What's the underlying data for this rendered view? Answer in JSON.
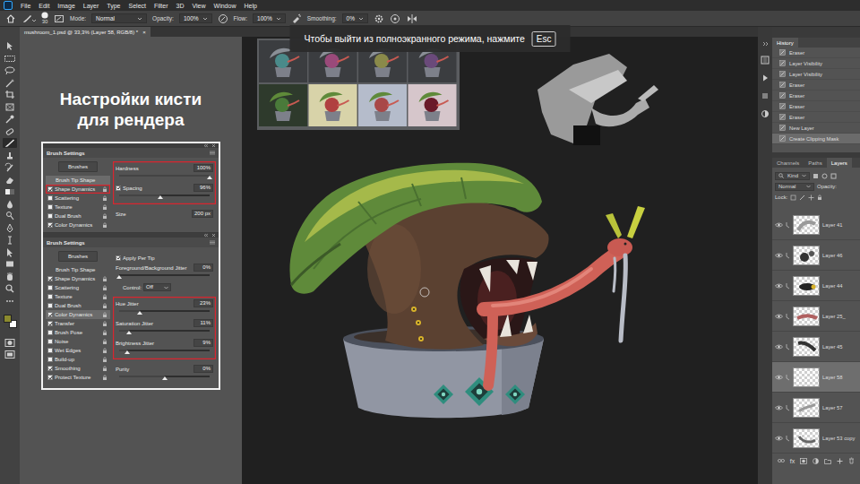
{
  "menu": {
    "items": [
      "File",
      "Edit",
      "Image",
      "Layer",
      "Type",
      "Select",
      "Filter",
      "3D",
      "View",
      "Window",
      "Help"
    ]
  },
  "options_bar": {
    "brush_size": "30",
    "mode_label": "Mode:",
    "mode": "Normal",
    "opacity_label": "Opacity:",
    "opacity": "100%",
    "flow_label": "Flow:",
    "flow": "100%",
    "smoothing_label": "Smoothing:",
    "smoothing": "0%"
  },
  "tools": [
    {
      "selected": false
    },
    {
      "selected": false
    },
    {
      "selected": false
    },
    {
      "selected": false
    },
    {
      "selected": false
    },
    {
      "selected": false
    },
    {
      "selected": false
    },
    {
      "selected": false
    },
    {
      "selected": true
    },
    {
      "selected": false
    },
    {
      "selected": false
    },
    {
      "selected": false
    },
    {
      "selected": false
    },
    {
      "selected": false
    },
    {
      "selected": false
    },
    {
      "selected": false
    },
    {
      "selected": false
    },
    {
      "selected": false
    },
    {
      "selected": false
    },
    {
      "selected": false
    },
    {
      "selected": false
    },
    {
      "selected": false
    }
  ],
  "color_swatches": [
    {
      "color": "#8b8a2e"
    },
    {
      "color": "#ffffff"
    }
  ],
  "document_tab": {
    "title": "mushroom_1.psd @ 33,3% (Layer 58, RGB/8) *",
    "close": "×"
  },
  "fullscreen_notice": {
    "text": "Чтобы выйти из полноэкранного режима, нажмите",
    "key": "Esc"
  },
  "tutorial": {
    "heading": [
      "Настройки кисти",
      "для рендера"
    ],
    "panels": [
      {
        "title": "Brush Settings",
        "brushes_button": "Brushes",
        "options": [
          {
            "label": "Brush Tip Shape",
            "kind": "plain",
            "selected": true,
            "highlighted": false
          },
          {
            "label": "Shape Dynamics",
            "kind": "check",
            "checked": true,
            "selected": false,
            "highlighted": true
          },
          {
            "label": "Scattering",
            "kind": "check",
            "checked": false,
            "selected": false,
            "highlighted": false
          },
          {
            "label": "Texture",
            "kind": "check",
            "checked": false,
            "selected": false,
            "highlighted": false
          },
          {
            "label": "Dual Brush",
            "kind": "check",
            "checked": false,
            "selected": false,
            "highlighted": false
          },
          {
            "label": "Color Dynamics",
            "kind": "check",
            "checked": true,
            "selected": false,
            "highlighted": false
          }
        ],
        "sections": [
          {
            "highlighted": true,
            "controls": [
              {
                "kind": "slider",
                "label": "Hardness",
                "value": "100%",
                "level": 1
              },
              {
                "kind": "check-slider",
                "label": "Spacing",
                "checked": true,
                "value": "96%",
                "level": 0.46
              }
            ]
          },
          {
            "highlighted": false,
            "controls": [
              {
                "kind": "field",
                "label": "Size",
                "value": "200 px"
              }
            ]
          }
        ]
      },
      {
        "title": "Brush Settings",
        "brushes_button": "Brushes",
        "options": [
          {
            "label": "Brush Tip Shape",
            "kind": "plain",
            "selected": false,
            "highlighted": false
          },
          {
            "label": "Shape Dynamics",
            "kind": "check",
            "checked": true,
            "selected": false,
            "highlighted": false
          },
          {
            "label": "Scattering",
            "kind": "check",
            "checked": false,
            "selected": false,
            "highlighted": false
          },
          {
            "label": "Texture",
            "kind": "check",
            "checked": false,
            "selected": false,
            "highlighted": false
          },
          {
            "label": "Dual Brush",
            "kind": "check",
            "checked": false,
            "selected": false,
            "highlighted": false
          },
          {
            "label": "Color Dynamics",
            "kind": "check",
            "checked": true,
            "selected": true,
            "highlighted": true
          },
          {
            "label": "Transfer",
            "kind": "check",
            "checked": true,
            "selected": false,
            "highlighted": false
          },
          {
            "label": "Brush Pose",
            "kind": "check",
            "checked": false,
            "selected": false,
            "highlighted": false
          },
          {
            "label": "Noise",
            "kind": "check",
            "checked": false,
            "selected": false,
            "highlighted": false
          },
          {
            "label": "Wet Edges",
            "kind": "check",
            "checked": false,
            "selected": false,
            "highlighted": false
          },
          {
            "label": "Build-up",
            "kind": "check",
            "checked": false,
            "selected": false,
            "highlighted": false
          },
          {
            "label": "Smoothing",
            "kind": "check",
            "checked": true,
            "selected": false,
            "highlighted": false
          },
          {
            "label": "Protect Texture",
            "kind": "check",
            "checked": true,
            "selected": false,
            "highlighted": false
          }
        ],
        "sections": [
          {
            "highlighted": false,
            "controls": [
              {
                "kind": "check",
                "label": "Apply Per Tip",
                "checked": true
              },
              {
                "kind": "slider",
                "label": "Foreground/Background Jitter",
                "value": "0%",
                "level": 0
              },
              {
                "kind": "dropdown",
                "label": "Control:",
                "value": "Off"
              }
            ]
          },
          {
            "highlighted": true,
            "controls": [
              {
                "kind": "slider",
                "label": "Hue Jitter",
                "value": "23%",
                "level": 0.23
              },
              {
                "kind": "slider",
                "label": "Saturation Jitter",
                "value": "11%",
                "level": 0.11
              },
              {
                "kind": "slider",
                "label": "Brightness Jitter",
                "value": "9%",
                "level": 0.09
              }
            ]
          },
          {
            "highlighted": false,
            "controls": [
              {
                "kind": "slider",
                "label": "Purity",
                "value": "0%",
                "level": 0.5
              }
            ]
          }
        ]
      }
    ]
  },
  "history": {
    "title": "History",
    "items": [
      {
        "label": "Eraser",
        "selected": false
      },
      {
        "label": "Layer Visibility",
        "selected": false
      },
      {
        "label": "Layer Visibility",
        "selected": false
      },
      {
        "label": "Eraser",
        "selected": false
      },
      {
        "label": "Eraser",
        "selected": false
      },
      {
        "label": "Eraser",
        "selected": false
      },
      {
        "label": "Eraser",
        "selected": false
      },
      {
        "label": "New Layer",
        "selected": false
      },
      {
        "label": "Create Clipping Mask",
        "selected": true
      }
    ]
  },
  "layers": {
    "tabs": [
      {
        "label": "Channels",
        "selected": false
      },
      {
        "label": "Paths",
        "selected": false
      },
      {
        "label": "Layers",
        "selected": true
      }
    ],
    "filter": "Kind",
    "blend_mode": "Normal",
    "opacity_label": "Opacity:",
    "lock_label": "Lock:",
    "items": [
      {
        "name": "Layer 41",
        "visible": true,
        "selected": false
      },
      {
        "name": "Layer 46",
        "visible": true,
        "selected": false
      },
      {
        "name": "Layer 44",
        "visible": true,
        "selected": false
      },
      {
        "name": "Layer 25_",
        "visible": true,
        "selected": false
      },
      {
        "name": "Layer 45",
        "visible": true,
        "selected": false
      },
      {
        "name": "Layer 58",
        "visible": true,
        "selected": true
      },
      {
        "name": "Layer 57",
        "visible": true,
        "selected": false
      },
      {
        "name": "Layer 53 copy",
        "visible": true,
        "selected": false
      }
    ],
    "footer_fx": "fx"
  }
}
